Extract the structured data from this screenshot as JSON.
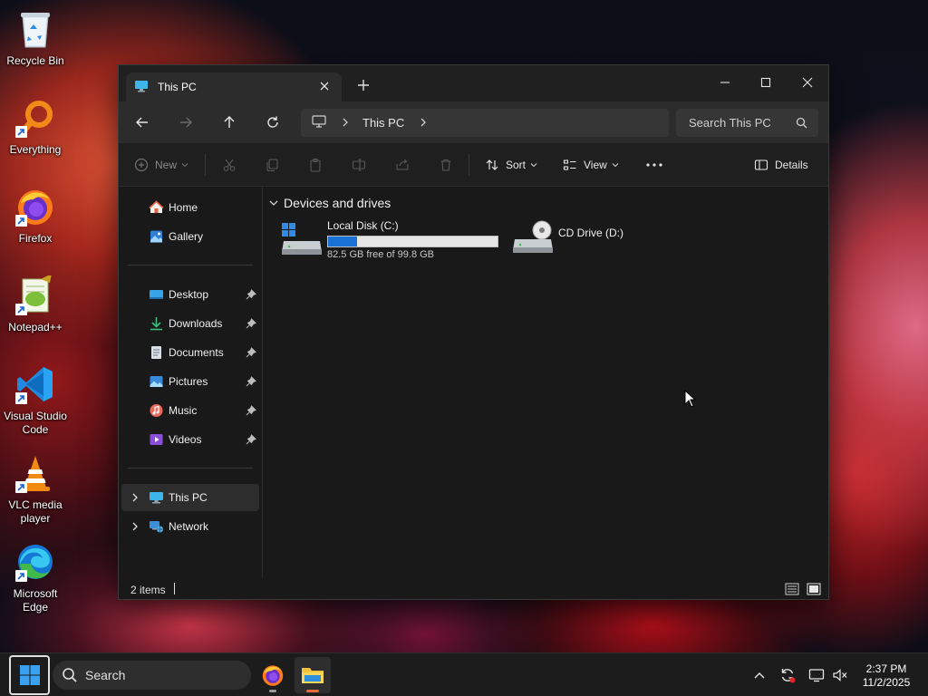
{
  "desktop": {
    "icons": [
      {
        "label": "Recycle Bin",
        "icon": "recycle-bin-icon"
      },
      {
        "label": "Everything",
        "icon": "everything-search-icon"
      },
      {
        "label": "Firefox",
        "icon": "firefox-icon"
      },
      {
        "label": "Notepad++",
        "icon": "notepad-plus-plus-icon"
      },
      {
        "label": "Visual Studio Code",
        "icon": "vscode-icon"
      },
      {
        "label": "VLC media player",
        "icon": "vlc-icon"
      },
      {
        "label": "Microsoft Edge",
        "icon": "edge-icon"
      }
    ]
  },
  "window": {
    "tab_title": "This PC",
    "controls": {
      "minimize": "minimize-icon",
      "maximize": "maximize-icon",
      "close": "close-icon"
    },
    "address": {
      "root_icon": "monitor-icon",
      "crumbs": [
        "This PC"
      ]
    },
    "search": {
      "placeholder": "Search This PC"
    },
    "toolbar": {
      "new_label": "New",
      "sort_label": "Sort",
      "view_label": "View",
      "details_label": "Details"
    },
    "sidebar": {
      "top": [
        {
          "label": "Home",
          "icon": "home-icon"
        },
        {
          "label": "Gallery",
          "icon": "gallery-icon"
        }
      ],
      "pinned": [
        {
          "label": "Desktop",
          "icon": "desktop-folder-icon"
        },
        {
          "label": "Downloads",
          "icon": "download-icon"
        },
        {
          "label": "Documents",
          "icon": "documents-icon"
        },
        {
          "label": "Pictures",
          "icon": "pictures-icon"
        },
        {
          "label": "Music",
          "icon": "music-icon"
        },
        {
          "label": "Videos",
          "icon": "videos-icon"
        }
      ],
      "tree": [
        {
          "label": "This PC",
          "icon": "this-pc-icon",
          "selected": true
        },
        {
          "label": "Network",
          "icon": "network-icon",
          "selected": false
        }
      ]
    },
    "content": {
      "group_title": "Devices and drives",
      "drives": [
        {
          "name": "Local Disk (C:)",
          "free_text": "82.5 GB free of 99.8 GB",
          "used_fraction": 0.173
        },
        {
          "name": "CD Drive (D:)"
        }
      ]
    },
    "status": {
      "items_text": "2 items"
    }
  },
  "taskbar": {
    "search_placeholder": "Search",
    "clock": {
      "time": "2:37 PM",
      "date": "11/2/2025"
    },
    "apps": [
      "firefox-icon",
      "file-explorer-icon"
    ],
    "tray": [
      "chevron-up-icon",
      "sync-icon",
      "network-icon",
      "volume-muted-icon"
    ]
  },
  "colors": {
    "accent": "#1a73d4",
    "selected_bg": "#2d2d2d"
  }
}
